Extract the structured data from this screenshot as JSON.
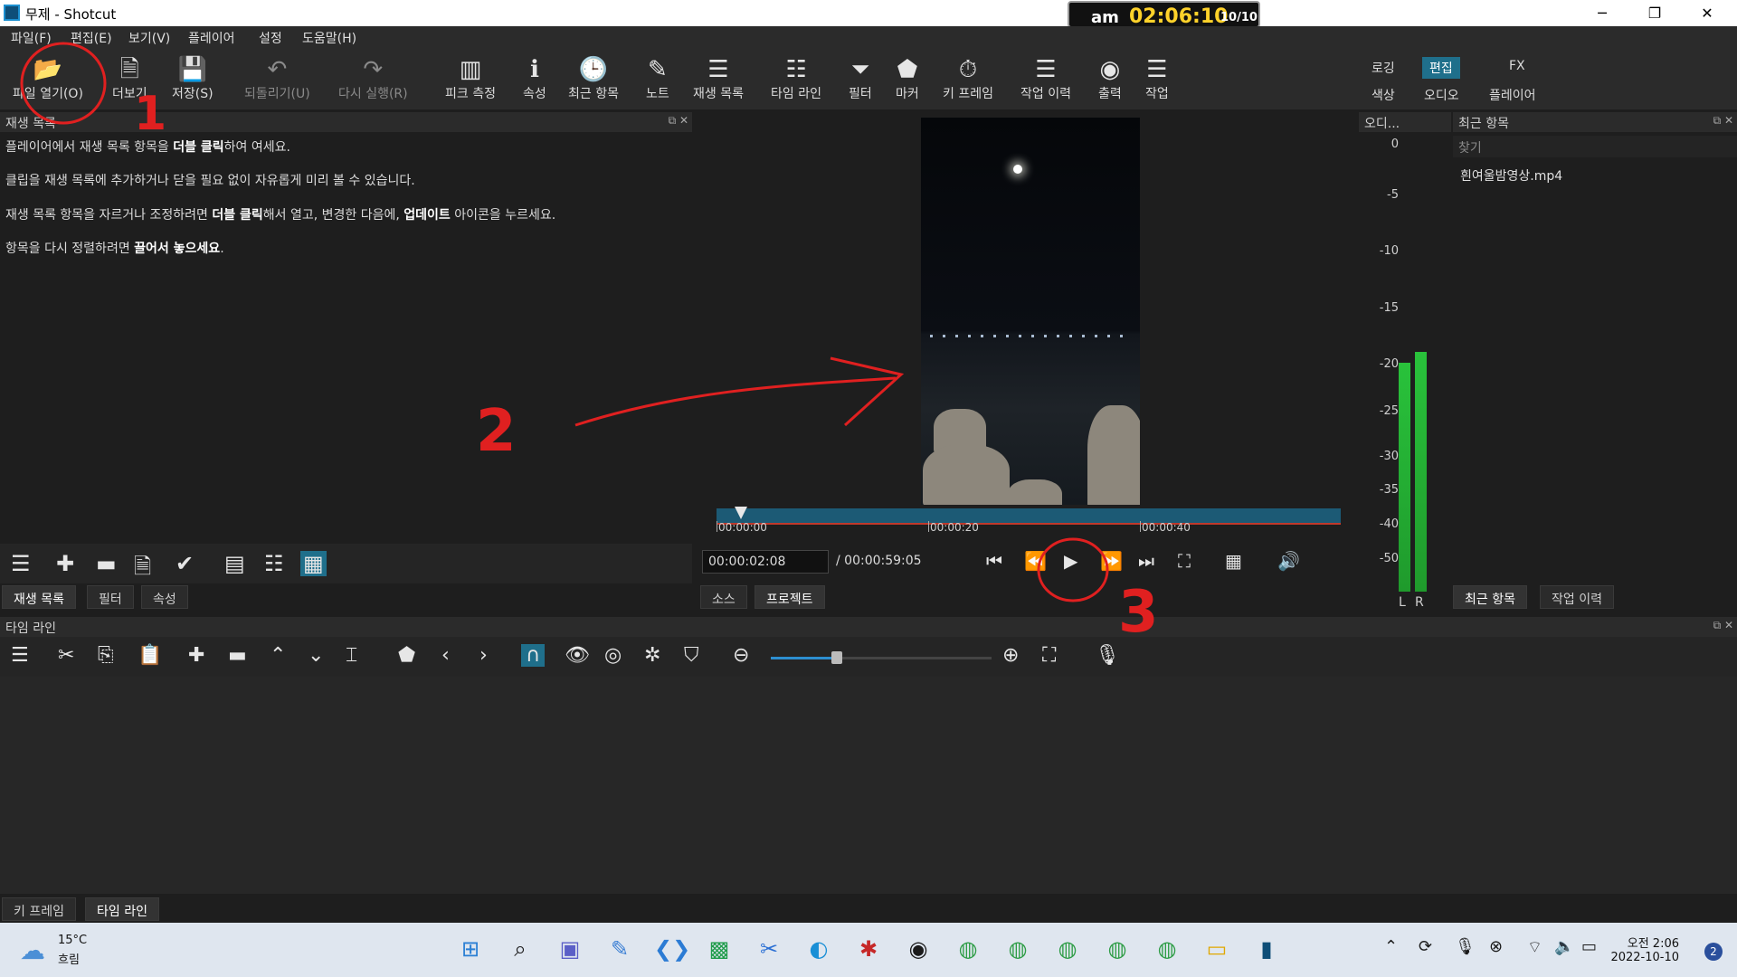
{
  "window": {
    "title": "무제 - Shotcut",
    "clock_ampm": "am",
    "clock_time": "02:06:10",
    "clock_date": "10/10",
    "controls": {
      "minimize": "─",
      "maximize": "❐",
      "close": "✕"
    }
  },
  "menu": [
    "파일(F)",
    "편집(E)",
    "보기(V)",
    "플레이어",
    "설정",
    "도움말(H)"
  ],
  "toolbar": {
    "items": [
      {
        "label": "파일 열기(O)",
        "icon": "📂"
      },
      {
        "label": "더보기",
        "icon": "🗎"
      },
      {
        "label": "저장(S)",
        "icon": "💾"
      },
      {
        "label": "되돌리기(U)",
        "icon": "↶"
      },
      {
        "label": "다시 실행(R)",
        "icon": "↷"
      },
      {
        "label": "피크 측정",
        "icon": "▥"
      },
      {
        "label": "속성",
        "icon": "ℹ"
      },
      {
        "label": "최근 항목",
        "icon": "🕒"
      },
      {
        "label": "노트",
        "icon": "✎"
      },
      {
        "label": "재생 목록",
        "icon": "☰"
      },
      {
        "label": "타임 라인",
        "icon": "☷"
      },
      {
        "label": "필터",
        "icon": "⏷"
      },
      {
        "label": "마커",
        "icon": "⬟"
      },
      {
        "label": "키 프레임",
        "icon": "⏱"
      },
      {
        "label": "작업 이력",
        "icon": "☰"
      },
      {
        "label": "출력",
        "icon": "◉"
      },
      {
        "label": "작업",
        "icon": "☰"
      }
    ],
    "layouts": {
      "logging": "로깅",
      "editing": "편집",
      "fx": "FX",
      "color": "색상",
      "audio": "오디오",
      "player": "플레이어"
    }
  },
  "playlist": {
    "header": "재생 목록",
    "hints": [
      [
        "플레이어에서 재생 목록 항목을 ",
        "더블 클릭",
        "하여 여세요."
      ],
      [
        "클립을 재생 목록에 추가하거나 닫을 필요 없이 자유롭게 미리 볼 수 있습니다.",
        "",
        ""
      ],
      [
        "재생 목록 항목을 자르거나 조정하려면 ",
        "더블 클릭",
        "해서 열고, 변경한 다음에, ",
        "업데이트",
        " 아이콘을 누르세요."
      ],
      [
        "항목을 다시 정렬하려면 ",
        "끌어서 놓으세요",
        "."
      ]
    ],
    "tabs": [
      "재생 목록",
      "필터",
      "속성"
    ]
  },
  "viewer": {
    "ruler_labels": [
      "00:00:00",
      "00:00:20",
      "00:00:40"
    ],
    "position": "00:00:02:08",
    "duration": "/ 00:00:59:05",
    "tabs": [
      "소스",
      "프로젝트"
    ]
  },
  "audio_meter": {
    "header": "오디...",
    "scale": [
      "0",
      "-5",
      "-10",
      "-15",
      "-20",
      "-25",
      "-30",
      "-35",
      "-40",
      "-50"
    ],
    "left_label": "L",
    "right_label": "R",
    "level_L_db": -20,
    "level_R_db": -19
  },
  "recent": {
    "header": "최근 항목",
    "search_placeholder": "찾기",
    "items": [
      "흰여울밤영상.mp4"
    ],
    "tabs": [
      "최근 항목",
      "작업 이력"
    ]
  },
  "timeline": {
    "header": "타임 라인",
    "zoom_fraction": 0.3,
    "tabs": [
      "키 프레임",
      "타임 라인"
    ]
  },
  "taskbar": {
    "temperature": "15°C",
    "condition": "흐림",
    "time": "오전 2:06",
    "date": "2022-10-10",
    "notifications": "2"
  },
  "annotations": {
    "label1": "1",
    "label2": "2",
    "label3": "3"
  },
  "colors": {
    "accent": "#1f6f8b",
    "annotation": "#e02020",
    "meter": "#29c23b",
    "clock_time": "#ffd22a"
  }
}
